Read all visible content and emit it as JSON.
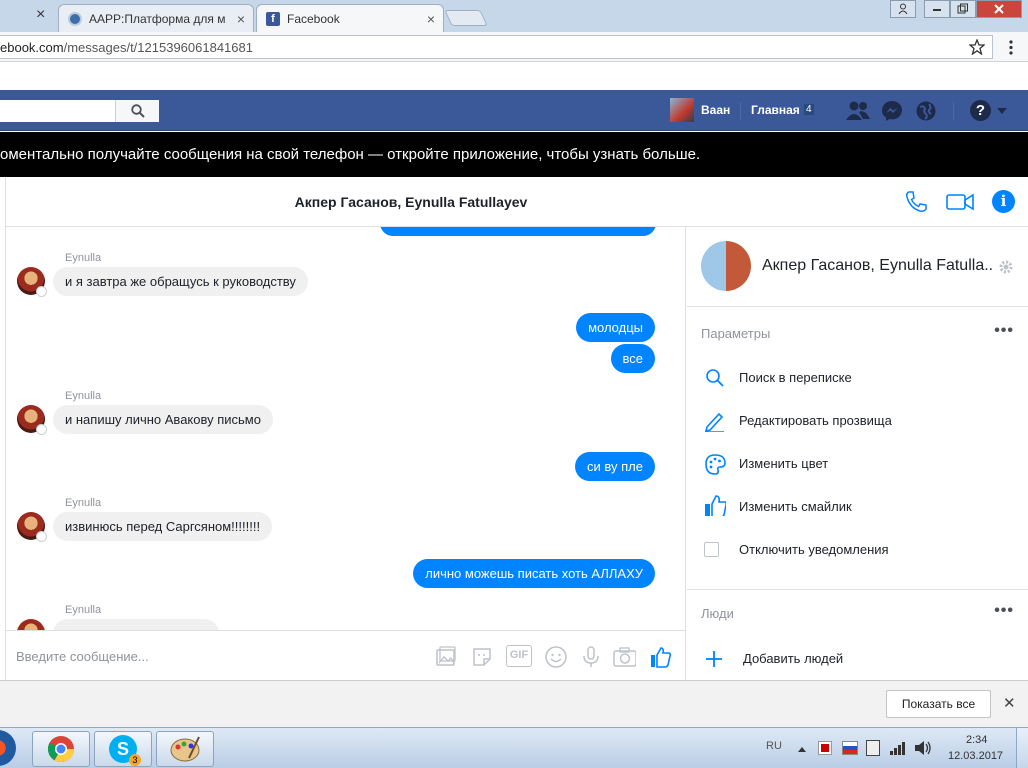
{
  "browser": {
    "tabs": [
      {
        "title": "AAPP:Платформа для м"
      },
      {
        "title": "Facebook"
      }
    ],
    "url_host": "ebook.com",
    "url_path": "/messages/t/1215396061841681",
    "close_glyph": "×"
  },
  "fb": {
    "user_name": "Ваан",
    "home_label": "Главная",
    "home_count": "4",
    "help_label": "?"
  },
  "banner": {
    "text": "оментально получайте сообщения на свой телефон — откройте приложение, чтобы узнать больше."
  },
  "conversation": {
    "title": "Акпер Гасанов, Eynulla Fatullayev",
    "messages": [
      {
        "sender": "Eynulla",
        "text": "и я завтра же обращусь к руководству"
      },
      {
        "text": "молодцы"
      },
      {
        "text": "все"
      },
      {
        "sender": "Eynulla",
        "text": "и напишу лично Авакову письмо"
      },
      {
        "text": "си ву пле"
      },
      {
        "sender": "Eynulla",
        "text": "извинюсь перед Саргсяном!!!!!!!!"
      },
      {
        "text": "лично можешь писать хоть  АЛЛАХУ"
      },
      {
        "sender": "Eynulla"
      }
    ],
    "composer_placeholder": "Введите сообщение...",
    "gif_label": "GIF"
  },
  "sidebar": {
    "name": "Акпер Гасанов, Eynulla Fatulla...",
    "params_title": "Параметры",
    "options": [
      {
        "label": "Поиск в переписке",
        "icon": "search-icon"
      },
      {
        "label": "Редактировать прозвища",
        "icon": "pencil-icon"
      },
      {
        "label": "Изменить цвет",
        "icon": "palette-icon"
      },
      {
        "label": "Изменить смайлик",
        "icon": "thumbs-up-icon"
      },
      {
        "label": "Отключить уведомления",
        "icon": "checkbox-icon"
      }
    ],
    "people_title": "Люди",
    "add_people": "Добавить людей",
    "more_glyph": "•••"
  },
  "downloads": {
    "show_all": "Показать все",
    "close_glyph": "✕"
  },
  "taskbar": {
    "skype_badge": "3",
    "lang": "RU",
    "time": "2:34",
    "date": "12.03.2017"
  },
  "colors": {
    "fb_blue": "#3b5998",
    "messenger_blue": "#0084ff"
  }
}
